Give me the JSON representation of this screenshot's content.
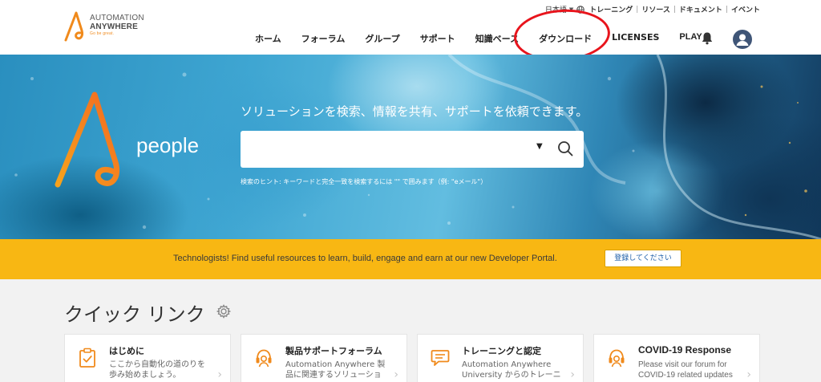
{
  "header": {
    "logo": {
      "line1": "AUTOMATION",
      "line2": "ANYWHERE",
      "tagline": "Go be great."
    },
    "utility": {
      "language": "日本語",
      "links": [
        "トレーニング",
        "リソース",
        "ドキュメント",
        "イベント"
      ]
    },
    "nav": [
      "ホーム",
      "フォーラム",
      "グループ",
      "サポート",
      "知識ベース",
      "ダウンロード",
      "LICENSES",
      "PLAY"
    ],
    "icons": {
      "bell": "bell-icon",
      "avatar": "user-avatar-icon",
      "globe": "globe-icon"
    }
  },
  "hero": {
    "brand": "people",
    "title": "ソリューションを検索、情報を共有、サポートを依頼できます。",
    "search": {
      "value": "",
      "placeholder": ""
    },
    "hint": "検索のヒント: キーワードと完全一致を検索するには \"\" で囲みます（例: \"eメール\"）"
  },
  "banner": {
    "text": "Technologists! Find useful resources to learn, build, engage and earn at our new Developer Portal.",
    "button": "登録してください"
  },
  "quick_links": {
    "title": "クイック リンク",
    "cards": [
      {
        "title": "はじめに",
        "desc": "ここから自動化の道のりを歩み始めましょう。",
        "icon": "clipboard-check-icon"
      },
      {
        "title": "製品サポートフォーラム",
        "desc": "Automation Anywhere 製品に関連するソリューショ",
        "icon": "headset-icon"
      },
      {
        "title": "トレーニングと認定",
        "desc": "Automation Anywhere University からのトレーニ",
        "icon": "speech-bubble-icon"
      },
      {
        "title": "COVID-19 Response",
        "desc": "Please visit our forum for COVID-19 related updates",
        "icon": "headset-icon"
      }
    ]
  },
  "colors": {
    "brand_orange": "#f08a1c",
    "banner_yellow": "#f8b713",
    "highlight_red": "#e8141c"
  }
}
